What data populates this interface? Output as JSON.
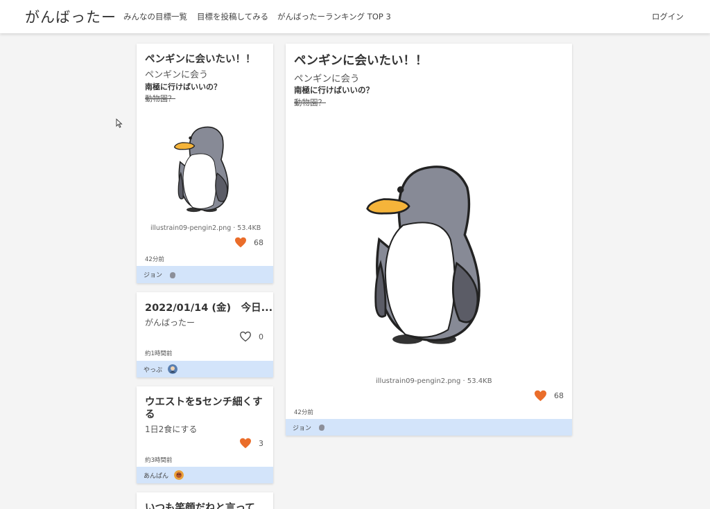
{
  "app": {
    "brand": "がんばったー",
    "nav": [
      {
        "label": "みんなの目標一覧"
      },
      {
        "label": "目標を投稿してみる"
      },
      {
        "label": "がんばったーランキング TOP 3"
      }
    ],
    "login": "ログイン"
  },
  "cards": [
    {
      "title": "ペンギンに会いたい！！",
      "subtitle": "ペンギンに会う",
      "bold_line": "南極に行けばいいの？",
      "strike_line": "動物園？",
      "image_caption": "illustrain09-pengin2.png · 53.4KB",
      "likes": "68",
      "liked": true,
      "time": "42分前",
      "author": "ジョン"
    },
    {
      "title": "2022/01/14 (金)　今日...",
      "subtitle": "がんばったー",
      "likes": "0",
      "liked": false,
      "time": "約1時間前",
      "author": "やっぷ"
    },
    {
      "title_line1": "ウエストを5センチ細くす",
      "title_line2": "る",
      "subtitle": "1日2食にする",
      "likes": "3",
      "liked": true,
      "time": "約3時間前",
      "author": "あんぱん"
    },
    {
      "title": "いつも笑顔だねと言って"
    }
  ],
  "detail": {
    "title": "ペンギンに会いたい！！",
    "subtitle": "ペンギンに会う",
    "bold_line": "南極に行けばいいの？",
    "strike_line": "動物園？",
    "image_caption": "illustrain09-pengin2.png · 53.4KB",
    "likes": "68",
    "liked": true,
    "time": "42分前",
    "author": "ジョン"
  },
  "colors": {
    "heart": "#ea6d2a",
    "author_bar": "#d3e4fa",
    "background": "#f4f4f4"
  }
}
